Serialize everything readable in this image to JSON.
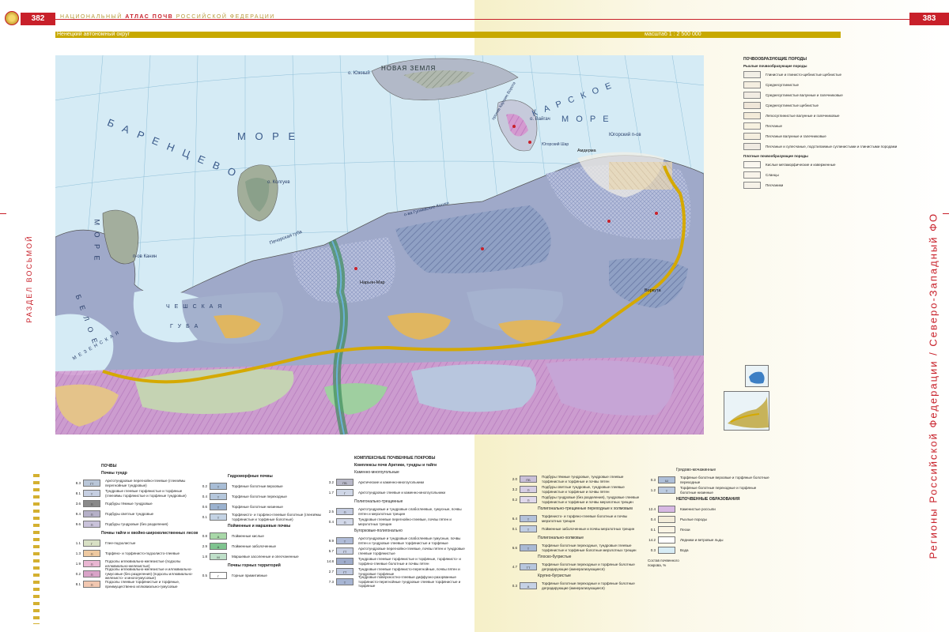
{
  "header": {
    "page_left": "382",
    "page_right": "383",
    "title_prefix": "НАЦИОНАЛЬНЫЙ",
    "title_bold": "АТЛАС ПОЧВ",
    "title_suffix": "РОССИЙСКОЙ ФЕДЕРАЦИИ",
    "region": "Ненецкий автономный округ",
    "scale": "масштаб 1 : 2 500 000"
  },
  "side": {
    "left": "РАЗДЕЛ ВОСЬМОЙ",
    "right": "Регионы Российской Федерации / Северо-Западный ФО"
  },
  "map": {
    "labels": {
      "novaya_zemlya": "НОВАЯ ЗЕМЛЯ",
      "yuzhny": "о. Южный",
      "barents1": "Б А Р Е Н Ц Е В О",
      "barents2": "М О Р Е",
      "kara1": "К А Р С К О Е",
      "kara2": "М О Р Е",
      "vaygach": "о. Вайгач",
      "kolguev": "о. Колгуев",
      "guliaevskie": "о-ва Гуляевские Кошки",
      "pechora_bay": "Печорская губа",
      "kanin": "п-ов Канин",
      "cheshskaya": "Ч Е Ш С К А Я",
      "guba": "Г У Б А",
      "beloe1": "Б Е Л О Е",
      "beloe2": "М О Р Е",
      "mezen": "М Е З Е Н С К А Я",
      "yugorsky": "Югорский п-ов",
      "naryan_mar": "Нарьян-Мар",
      "amderma": "Амдерма",
      "vorkuta": "Воркута",
      "karskie_vorota": "пролив Карские Ворота",
      "yugorsky_shar": "Югорский Шар"
    }
  },
  "parent_legend": {
    "title": "ПОЧВООБРАЗУЮЩИЕ ПОРОДЫ",
    "group1": "Рыхлые почвообразующие породы",
    "items1": [
      {
        "label": "Глинистые и глинисто-щебнистые щебнистые",
        "color": "#f2efe6"
      },
      {
        "label": "Среднесуглинистые",
        "color": "#f4eee0"
      },
      {
        "label": "Среднесуглинистые валунные и галечниковые",
        "color": "#f1ece2"
      },
      {
        "label": "Среднесуглинистые щебнистые",
        "color": "#efe6d8"
      },
      {
        "label": "Легкосуглинистые валунные и галечниковые",
        "color": "#f3ebd9"
      },
      {
        "label": "Песчаные",
        "color": "#f7f2e0"
      },
      {
        "label": "Песчаные валунные и галечниковые",
        "color": "#f5efdf"
      },
      {
        "label": "Песчаные и супесчаные, подстилаемые суглинистыми и глинистыми породами",
        "color": "#f0ebe2"
      }
    ],
    "group2": "Плотные почвообразующие породы",
    "items2": [
      {
        "label": "Кислые метаморфические и изверженные",
        "color": "#faf7ef"
      },
      {
        "label": "Сланцы",
        "color": "#f8f4ea"
      },
      {
        "label": "Песчаники",
        "color": "#f6f2e8"
      }
    ]
  },
  "legend": {
    "col1": {
      "title": "ПОЧВЫ",
      "sub1": "Почвы тундр",
      "items1": [
        {
          "num": "8.3",
          "code": "ГТ",
          "color": "#b9c6d8",
          "label": "Арктотундровые перегнойно-глеевые (глеезёмы перегнойные тундровые)"
        },
        {
          "num": "8.1",
          "code": "Т",
          "color": "#c6cfe2",
          "label": "Тундровые глеевые торфянистые и торфяные (глеезёмы торфянистые и торфяные тундровые)"
        },
        {
          "num": "3.6",
          "code": "П",
          "color": "#8a8a8a",
          "label": "Подбуры тёмные тундровые"
        },
        {
          "num": "9.4",
          "code": "П",
          "color": "#b5b0c8",
          "label": "Подбуры светлые тундровые"
        },
        {
          "num": "9.6",
          "code": "П",
          "color": "#c9c2da",
          "label": "Подбуры тундровые (без разделения)"
        }
      ],
      "sub2": "Почвы тайги и хвойно-широколиственных лесов",
      "items2": [
        {
          "num": "1.1",
          "code": "Г",
          "color": "#d8e0c4",
          "label": "Глее-подзолистые"
        },
        {
          "num": "1.3",
          "code": "П",
          "color": "#eec9a0",
          "label": "Торфяно- и торфянисто-подзолисто-глеевые"
        },
        {
          "num": "1.9",
          "code": "П",
          "color": "#e9b6d2",
          "label": "Подзолы иллювиально-железистые (подзолы иллювиально-железистые)"
        },
        {
          "num": "0.2",
          "code": "П",
          "color": "#d9a3c8",
          "label": "Подзолы иллювиально-железистые и иллювиально-гумусовые (без разделения) (подзолы иллювиально-железисто- и многогумусовые)"
        },
        {
          "num": "8.1",
          "code": "П",
          "color": "#f1c7b0",
          "label": "Подзолы глеевые торфянистые и торфяные, преимущественно иллювиально-гумусовые"
        }
      ]
    },
    "col2": {
      "sub1": "Гидроморфные почвы",
      "items1": [
        {
          "num": "0.2",
          "code": "Т",
          "color": "#a8bdd6",
          "label": "Торфяные болотные верховые"
        },
        {
          "num": "0.4",
          "code": "Т",
          "color": "#b5c7dc",
          "label": "Торфяные болотные переходные"
        },
        {
          "num": "0.6",
          "code": "Т",
          "color": "#9bb2cf",
          "label": "Торфяные болотные низинные"
        },
        {
          "num": "0.1",
          "code": "Т",
          "color": "#c4d3e4",
          "label": "Торфянисто- и торфяно-глеевые болотные (глеезёмы торфянистые и торфяные болотные)"
        }
      ],
      "sub2": "Пойменные и маршевые почвы",
      "items2": [
        {
          "num": "0.8",
          "code": "А",
          "color": "#a8d8a8",
          "label": "Пойменные кислые"
        },
        {
          "num": "2.9",
          "code": "А",
          "color": "#7fc48f",
          "label": "Пойменные заболоченные"
        },
        {
          "num": "1.8",
          "code": "М",
          "color": "#bfe0c9",
          "label": "Маршевые засоленные и опесчаненные"
        }
      ],
      "sub3": "Почвы горных территорий",
      "items3": [
        {
          "num": "0.5",
          "code": "Г",
          "color": "#ffffff",
          "label": "Горные примитивные"
        }
      ]
    },
    "col3": {
      "title": "КОМПЛЕКСНЫЕ ПОЧВЕННЫЕ ПОКРОВЫ",
      "sub1": "Комплексы почв Арктики, тундры и тайги",
      "sub1b": "Каменно-многоугольные",
      "items1": [
        {
          "num": "3.2",
          "code": "ПБ",
          "color": "#b8b8c8",
          "label": "Арктические и каменно-многоугольники"
        },
        {
          "num": "1.7",
          "code": "Г",
          "color": "#cfd6e6",
          "label": "Арктотундровые глеевые и каменно-многоугольники"
        }
      ],
      "sub2": "Полигонально-трещинные",
      "items2": [
        {
          "num": "2.5",
          "code": "П",
          "color": "#c3cbe0",
          "label": "Арктотундровые и тундровые слабоглеевые, гумусные, почвы пятен и мерзлотных трещин"
        },
        {
          "num": "0.4",
          "code": "П",
          "color": "#d2d8e8",
          "label": "Тундровые глеевые перегнойно-глеевые, почвы пятен и мерзлотных трещин"
        }
      ],
      "sub3": "Бугорковые-полигонально",
      "items3": [
        {
          "num": "9.9",
          "code": "Т",
          "color": "#b0bcd8",
          "label": "Арктотундровые и тундровые слабоглеевые гумусные, почвы пятен и тундровые глеевые торфянистые и торфяные"
        },
        {
          "num": "5.7",
          "code": "ГТ",
          "color": "#c8d0e4",
          "label": "Арктотундровые перегнойно-глеевые, почвы пятен и тундровые глеевые торфянистые"
        },
        {
          "num": "14.8",
          "code": "Т",
          "color": "#9faccb",
          "label": "Тундровые глеевые торфянистые и торфяные, торфянисто- и торфяно-глеевые болотные и почвы пятен"
        },
        {
          "num": "2.7",
          "code": "ГТ",
          "color": "#bec8df",
          "label": "Тундровые глеевые торфянисто-перегнойные, почвы пятен и тундровые торфяные"
        },
        {
          "num": "7.3",
          "code": "Т",
          "color": "#a7b5d3",
          "label": "Тундровые поверхностно-глеевые диффузно-разорванные торфянисто-перегнойные тундровые глеевые торфянистые и торфяные"
        }
      ]
    },
    "col4": {
      "items1": [
        {
          "num": "2.0",
          "code": "ПБ",
          "color": "#c9bfd8",
          "label": "Подбуры тёмные тундровые, тундровые глеевые торфянистые и торфяные и почвы пятен"
        },
        {
          "num": "3.2",
          "code": "П",
          "color": "#d6cde3",
          "label": "Подбуры светлые тундровые, тундровые глеевые торфянистые и торфяные и почвы пятен"
        },
        {
          "num": "0.2",
          "code": "П",
          "color": "#e0d8ea",
          "label": "Подбуры тундровые (без разделения), тундровые глеевые торфянистые и торфяные и почвы мерзлотных трещин"
        }
      ],
      "sub2": "Полигонально-трещинные переходные к холмовым",
      "items2": [
        {
          "num": "6.4",
          "code": "Т",
          "color": "#b3c1da",
          "label": "Торфянисто- и торфяно-глеевые болотные и почвы мерзлотных трещин"
        },
        {
          "num": "0.1",
          "code": "Т",
          "color": "#c0cde2",
          "label": "Пойменные заболоченные и почвы мерзлотных трещин"
        }
      ],
      "sub3": "Полигонально-холмовые",
      "items3": [
        {
          "num": "6.6",
          "code": "Т",
          "color": "#a9b9d4",
          "label": "Торфяные болотные переходные, тундровые глеевые торфянистые и торфяные болотные мерзлотных трещин"
        }
      ],
      "sub4": "Плоско-бугристые",
      "items4": [
        {
          "num": "4.7",
          "code": "ТТ",
          "color": "#b7c6dd",
          "label": "Торфяные болотные переходные и торфяные болотные деградирующие (минерализующиеся)"
        }
      ],
      "sub5": "Крупно-бугристые",
      "items5": [
        {
          "num": "0.3",
          "code": "А",
          "color": "#c5d1e5",
          "label": "Торфяные болотные переходные и торфяные болотные деградирующие (минерализующиеся)"
        }
      ]
    },
    "col5": {
      "sub1": "Грядово-мочажинные",
      "items1": [
        {
          "num": "0.3",
          "code": "Ш",
          "color": "#aebfd8",
          "label": "Торфяные болотные верховые и торфяные болотные переходные"
        },
        {
          "num": "1.2",
          "code": "Т",
          "color": "#bccbe0",
          "label": "Торфяные болотные переходные и торфяные болотные низинные"
        }
      ],
      "sub2": "НЕПОЧВЕННЫЕ ОБРАЗОВАНИЯ",
      "items2": [
        {
          "num": "12.4",
          "code": "",
          "color": "#d7b8e3",
          "label": "Каменистые россыпи"
        },
        {
          "num": "0.4",
          "code": "",
          "color": "#f3ecd9",
          "label": "Рыхлые породы"
        },
        {
          "num": "0.1",
          "code": "",
          "color": "#faf4e4",
          "label": "Пески"
        },
        {
          "num": "14.2",
          "code": "",
          "color": "#ffffff",
          "label": "Ледники и ветровые льды"
        },
        {
          "num": "0.3",
          "code": "",
          "color": "#d7ecf5",
          "label": "Вода"
        }
      ],
      "note": "Состав почвенного покрова, %"
    }
  }
}
